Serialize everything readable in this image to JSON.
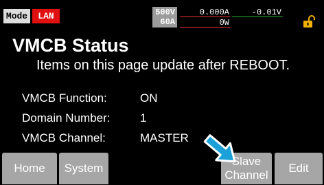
{
  "status_bar": {
    "mode_label": "Mode",
    "interface_label": "LAN",
    "voltage_limit": "500V",
    "current_limit": "60A",
    "current_reading": "0.000A",
    "power_reading": "0W",
    "voltage_reading": "-0.01V",
    "lock_icon": "padlock-unlocked-icon"
  },
  "page": {
    "title": "VMCB Status",
    "subtitle": "Items on this page update after REBOOT."
  },
  "fields": [
    {
      "label": "VMCB Function:",
      "value": "ON"
    },
    {
      "label": "Domain Number:",
      "value": "1"
    },
    {
      "label": "VMCB Channel:",
      "value": "MASTER"
    }
  ],
  "softkeys": {
    "home": "Home",
    "system": "System",
    "slave_line1": "Slave",
    "slave_line2": "Channel",
    "edit": "Edit"
  },
  "overlay": {
    "pointer_icon": "pointing-arrow-icon"
  },
  "colors": {
    "mode_badge": "#dddddd",
    "lan_badge": "#e01010",
    "softkey": "#a6a6a6",
    "lock": "#f0b000",
    "arrow": "#1ca0d8"
  }
}
